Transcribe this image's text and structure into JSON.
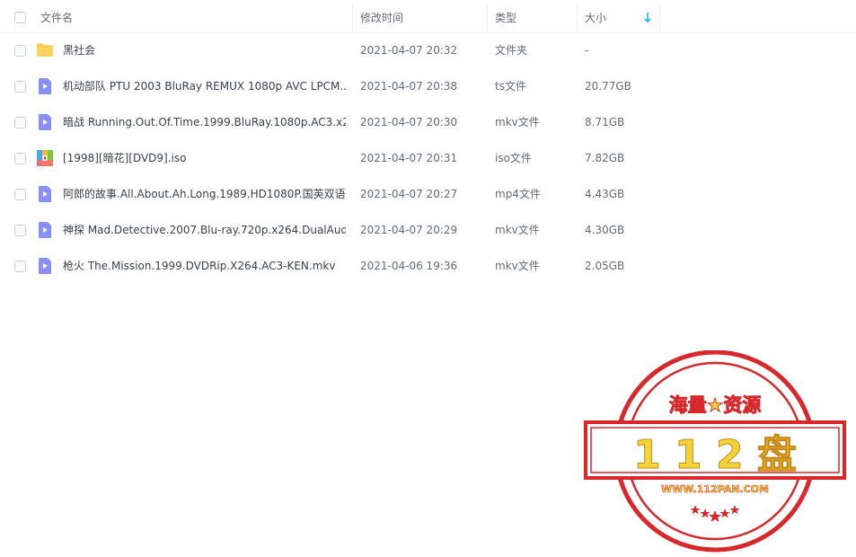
{
  "header": {
    "name_label": "文件名",
    "time_label": "修改时间",
    "type_label": "类型",
    "size_label": "大小"
  },
  "files": [
    {
      "icon": "folder-icon",
      "name": "黑社会",
      "time": "2021-04-07 20:32",
      "type": "文件夹",
      "size": "-"
    },
    {
      "icon": "video-file-icon",
      "name": "机动部队 PTU 2003 BluRay REMUX 1080p AVC LPCM...",
      "time": "2021-04-07 20:38",
      "type": "ts文件",
      "size": "20.77GB"
    },
    {
      "icon": "video-file-icon",
      "name": "暗战 Running.Out.Of.Time.1999.BluRay.1080p.AC3.x2...",
      "time": "2021-04-07 20:30",
      "type": "mkv文件",
      "size": "8.71GB"
    },
    {
      "icon": "archive-file-icon",
      "name": "[1998][暗花][DVD9].iso",
      "time": "2021-04-07 20:31",
      "type": "iso文件",
      "size": "7.82GB"
    },
    {
      "icon": "video-file-icon",
      "name": "阿郎的故事.All.About.Ah.Long.1989.HD1080P.国英双语...",
      "time": "2021-04-07 20:27",
      "type": "mp4文件",
      "size": "4.43GB"
    },
    {
      "icon": "video-file-icon",
      "name": "神探 Mad.Detective.2007.Blu-ray.720p.x264.DualAud...",
      "time": "2021-04-07 20:29",
      "type": "mkv文件",
      "size": "4.30GB"
    },
    {
      "icon": "video-file-icon",
      "name": "枪火 The.Mission.1999.DVDRip.X264.AC3-KEN.mkv",
      "time": "2021-04-06 19:36",
      "type": "mkv文件",
      "size": "2.05GB"
    }
  ],
  "watermark": {
    "top_text": "海量★资源",
    "main_text": "1 1 2 盘",
    "url_text": "WWW.112PAN.COM"
  },
  "colors": {
    "accent_blue": "#06a7ff",
    "folder_yellow": "#ffc94a",
    "video_purple": "#8b8ff5",
    "stamp_red": "#d8282c",
    "stamp_yellow": "#f2d338"
  }
}
